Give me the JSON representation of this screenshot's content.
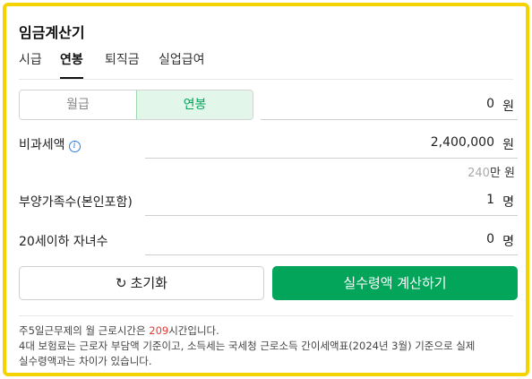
{
  "app": {
    "title": "임금계산기"
  },
  "tabs": [
    {
      "label": "시급",
      "active": false
    },
    {
      "label": "연봉",
      "active": true
    },
    {
      "label": "퇴직금",
      "active": false
    },
    {
      "label": "실업급여",
      "active": false
    }
  ],
  "pay_type_toggle": {
    "options": [
      "월급",
      "연봉"
    ],
    "selected": "연봉"
  },
  "salary": {
    "value": "0",
    "unit": "원"
  },
  "non_taxable": {
    "label": "비과세액",
    "info_icon": "i",
    "value": "2,400,000",
    "unit": "원"
  },
  "non_taxable_hint": {
    "number": "240",
    "unit": "만 원"
  },
  "dependents": {
    "label": "부양가족수(본인포함)",
    "value": "1",
    "unit": "명"
  },
  "children": {
    "label": "20세이하 자녀수",
    "value": "0",
    "unit": "명"
  },
  "buttons": {
    "reset": "초기화",
    "reset_icon": "↻",
    "calculate": "실수령액 계산하기"
  },
  "notes": {
    "line1_prefix": "주5일근무제의 월 근로시간은 ",
    "line1_hours": "209",
    "line1_suffix": "시간입니다.",
    "line2": "4대 보험료는 근로자 부담액 기준이고, 소득세는 국세청 근로소득 간이세액표(2024년 3월) 기준으로 실제",
    "line3": "실수령액과는 차이가 있습니다."
  },
  "colors": {
    "accent": "#03a55a",
    "frame": "#f5d300",
    "highlight": "#e53935"
  }
}
